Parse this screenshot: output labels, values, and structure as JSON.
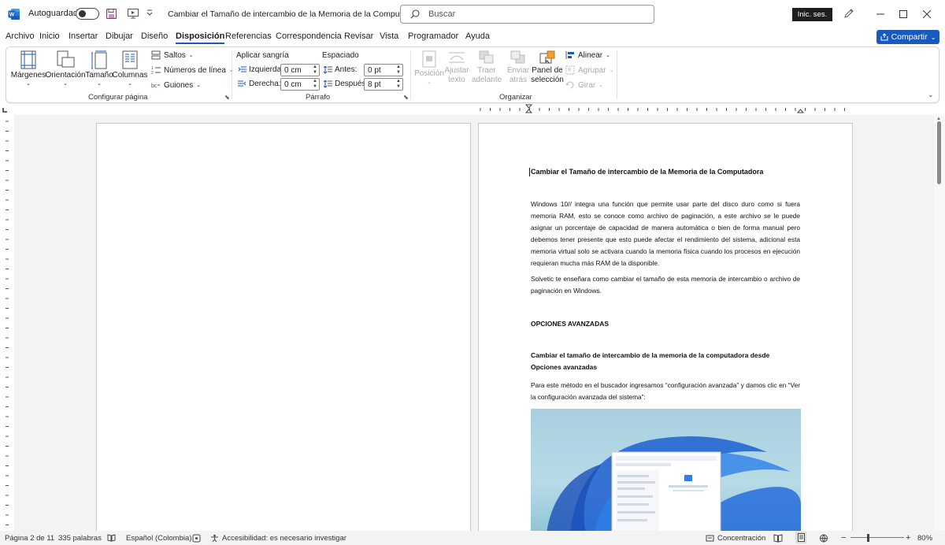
{
  "titlebar": {
    "autosave_label": "Autoguardado",
    "doc_title": "Cambiar el Tamaño de intercambio de la Memoria de la Computadora",
    "search_placeholder": "Buscar",
    "signin_label": "Inic. ses."
  },
  "menu": {
    "items": [
      "Archivo",
      "Inicio",
      "Insertar",
      "Dibujar",
      "Diseño",
      "Disposición",
      "Referencias",
      "Correspondencia",
      "Revisar",
      "Vista",
      "Programador",
      "Ayuda"
    ],
    "active": "Disposición",
    "share_label": "Compartir"
  },
  "ribbon": {
    "page_setup": {
      "margins": "Márgenes",
      "orientation": "Orientación",
      "size": "Tamaño",
      "columns": "Columnas",
      "breaks": "Saltos",
      "line_numbers": "Números de línea",
      "hyphenation": "Guiones",
      "group_label": "Configurar página"
    },
    "paragraph": {
      "indent_header": "Aplicar sangría",
      "spacing_header": "Espaciado",
      "left_label": "Izquierda:",
      "left_value": "0 cm",
      "right_label": "Derecha:",
      "right_value": "0 cm",
      "before_label": "Antes:",
      "before_value": "0 pt",
      "after_label": "Después:",
      "after_value": "8 pt",
      "group_label": "Párrafo"
    },
    "arrange": {
      "position": "Posición",
      "wrap_1": "Ajustar",
      "wrap_2": "texto",
      "forward_1": "Traer",
      "forward_2": "adelante",
      "backward_1": "Enviar",
      "backward_2": "atrás",
      "selection_1": "Panel de",
      "selection_2": "selección",
      "align": "Alinear",
      "group": "Agrupar",
      "rotate": "Girar",
      "group_label": "Organizar"
    }
  },
  "document": {
    "title": "Cambiar el Tamaño de intercambio de la Memoria de la Computadora",
    "para1": "Windows 10// integra una función que permite usar parte del disco duro como si fuera memoria RAM, esto se conoce como archivo de paginación, a este archivo se le puede asignar un porcentaje de capacidad de manera automática o bien de forma manual pero debemos tener presente que esto puede afectar el rendimiento del sistema, adicional esta memoria virtual solo se activara cuando la memoria física cuando los procesos en ejecución requieran mucha más RAM de la disponible.",
    "para2": "Solvetic te enseñara como cambiar el tamaño de esta memoria de intercambio o archivo de paginación en Windows.",
    "heading1": "OPCIONES AVANZADAS",
    "heading2": "Cambiar el tamaño de intercambio de la memoria de la computadora desde Opciones avanzadas",
    "para3": "Para este método en el buscador ingresamos “configuración avanzada” y damos clic en “Ver la configuración avanzada del sistema”:"
  },
  "status": {
    "page": "Página 2 de 11",
    "words": "335 palabras",
    "language": "Español (Colombia)",
    "accessibility": "Accesibilidad: es necesario investigar",
    "focus": "Concentración",
    "zoom": "80%"
  },
  "colors": {
    "accent": "#185abd",
    "word_blue": "#185abd"
  }
}
